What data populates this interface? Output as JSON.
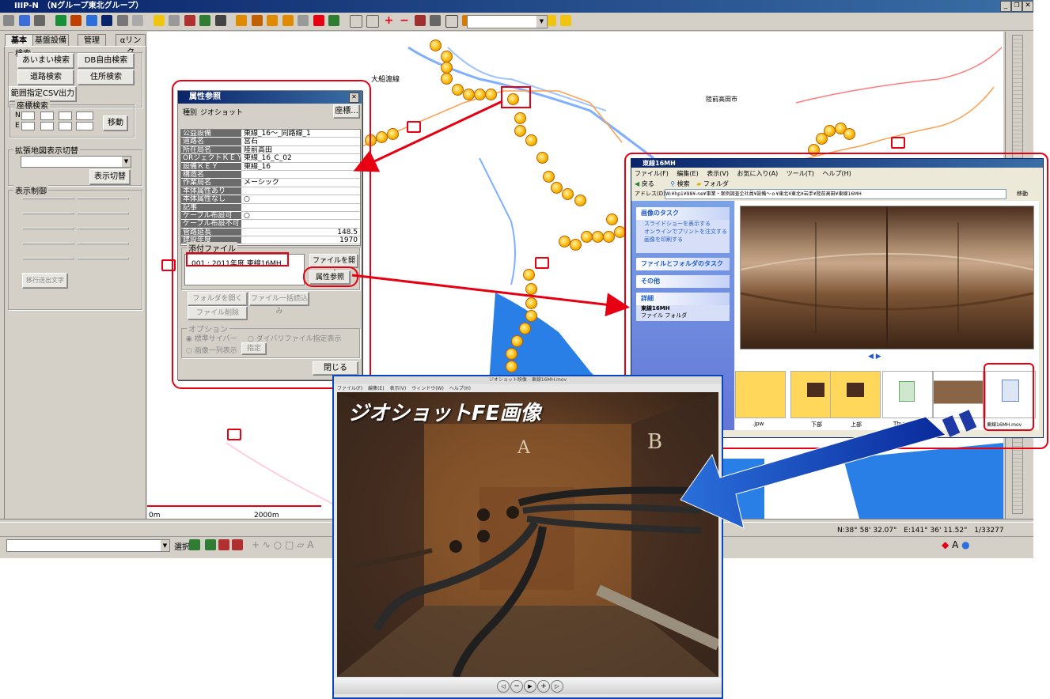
{
  "main_window": {
    "title": "IIIP-N　（Nグループ東北グループ）",
    "combo_value": ""
  },
  "left_panel": {
    "tabs": [
      "基本",
      "基盤設備",
      "管理",
      "αリンク"
    ],
    "search": {
      "title": "検索",
      "buttons": [
        "あいまい検索",
        "DB自由検索",
        "道路検索",
        "住所検索"
      ],
      "csv_button": "範囲指定CSV出力"
    },
    "coord_search": {
      "title": "座標検索",
      "n_label": "N",
      "e_label": "E",
      "move_button": "移動"
    },
    "ext_map": {
      "title": "拡張地図表示切替",
      "select_value": "",
      "switch_button": "表示切替"
    },
    "display_control": {
      "title": "表示制御",
      "bottom_button": "移行送出文字"
    }
  },
  "map": {
    "labels": {
      "line": "大船渡線",
      "city": "陸前高田市"
    },
    "scale": {
      "start": "0m",
      "end": "2000m"
    },
    "status_coords": "N:38° 58' 32.07\"　E:141° 36' 11.52\"　1/33277",
    "bottom_select": "",
    "select_label": "選択"
  },
  "attr_dialog": {
    "title": "属性参照",
    "type_label": "種別",
    "type_value": "ジオショット",
    "coord_button": "座標...",
    "rows": [
      {
        "key": "公益設備",
        "value": "東線_16～_同路線_1"
      },
      {
        "key": "道路名",
        "value": "宮石"
      },
      {
        "key": "所在局名",
        "value": "陸前高田"
      },
      {
        "key": "ORジェクトＫＥＹ",
        "value": "東線_16_C_02"
      },
      {
        "key": "設備ＫＥＹ",
        "value": "東線_16"
      },
      {
        "key": "構造名",
        "value": ""
      },
      {
        "key": "作業局名",
        "value": "メーシック"
      },
      {
        "key": "本体属性あり",
        "value": ""
      },
      {
        "key": "本体属性なし",
        "value": "○"
      },
      {
        "key": "記事",
        "value": ""
      },
      {
        "key": "ケーブル布設可",
        "value": "○"
      },
      {
        "key": "ケーブル布設不可",
        "value": ""
      },
      {
        "key": "管路延長",
        "value": "148.5"
      },
      {
        "key": "建設年度",
        "value": "1970"
      }
    ],
    "files_label": "添付ファイル",
    "file_entry": "001 : 2011年度 東線16MH",
    "open_file_button": "ファイルを開く",
    "attr_ref_button": "属性参照",
    "open_folder_button": "フォルダを開く",
    "bulk_load_button": "ファイル一括読込み",
    "file_delete_button": "ファイル削除",
    "options_label": "オプション",
    "option1": "標準サイバー",
    "option2": "ダイバリファイル指定表示",
    "option3": "画像一列表示",
    "option_button": "指定",
    "close_button": "閉じる"
  },
  "explorer": {
    "title": "東線16MH",
    "menu": [
      "ファイル(F)",
      "編集(E)",
      "表示(V)",
      "お気に入り(A)",
      "ツール(T)",
      "ヘルプ(H)"
    ],
    "toolbar": {
      "back": "戻る",
      "search": "検索",
      "folders": "フォルダ"
    },
    "address_label": "アドレス(D)",
    "address": "W:¥hp1¥98¥-ne¥事業・案例調査企社員¥設備～ｏ¥東北¥東北¥岩手¥陸前高田¥東線16MH",
    "go_button": "移動",
    "tasks": {
      "image_tasks": "画像のタスク",
      "items": [
        "スライドショーを表示する",
        "オンラインでプリントを注文する",
        "画像を印刷する"
      ],
      "file_tasks": "ファイルとフォルダのタスク",
      "other": "その他",
      "details": "詳細",
      "detail_name": "東線16MH",
      "detail_type": "ファイル フォルダ"
    },
    "files": [
      {
        "label": ".jpw"
      },
      {
        "label": "下部"
      },
      {
        "label": "上部"
      },
      {
        "label": "Thumbs.db"
      },
      {
        "label": ""
      },
      {
        "label": "東線16MH.mov"
      }
    ]
  },
  "viewer": {
    "title": "ジオショット映像 - 東線16MH.mov",
    "menu": [
      "ファイル(F)",
      "編集(E)",
      "表示(V)",
      "ウィンドウ(W)",
      "ヘルプ(H)"
    ],
    "caption": "ジオショットFE画像",
    "wall_labels": [
      "A",
      "B"
    ]
  }
}
